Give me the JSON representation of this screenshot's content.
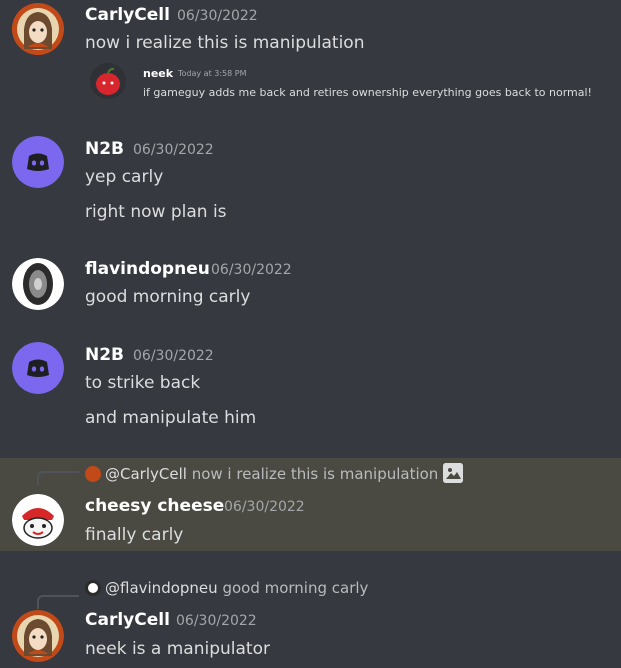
{
  "messages": [
    {
      "username": "CarlyCell",
      "timestamp": "06/30/2022",
      "lines": [
        "now i realize this is manipulation"
      ],
      "embed": {
        "username": "neek",
        "timestamp": "Today at 3:58 PM",
        "text": "if gameguy adds me back and retires ownership everything goes back to normal!"
      }
    },
    {
      "username": "N2B",
      "timestamp": "06/30/2022",
      "lines": [
        "yep carly",
        "right now plan is"
      ]
    },
    {
      "username": "flavindopneu",
      "timestamp": "06/30/2022",
      "lines": [
        "good morning carly"
      ]
    },
    {
      "username": "N2B",
      "timestamp": "06/30/2022",
      "lines": [
        "to strike back",
        "and manipulate him"
      ]
    },
    {
      "reply": {
        "mention": "@CarlyCell",
        "text": "now i realize this is manipulation",
        "has_image": true
      },
      "username": "cheesy cheese",
      "timestamp": "06/30/2022",
      "lines": [
        "finally carly"
      ]
    },
    {
      "reply": {
        "mention": "@flavindopneu",
        "text": "good morning carly"
      },
      "username": "CarlyCell",
      "timestamp": "06/30/2022",
      "lines": [
        "neek is a manipulator"
      ]
    }
  ],
  "colors": {
    "background": "#36393f",
    "highlight": "#4b4a42",
    "username": "#ffffff",
    "timestamp": "#a3a6aa",
    "text": "#dcddde",
    "discord_blurple": "#7b68ee"
  },
  "icons": {
    "carlycell_avatar": "anime-avatar",
    "n2b_avatar": "discord-default-avatar",
    "flavindopneu_avatar": "tire-avatar",
    "cheesy_avatar": "mascot-avatar",
    "neek_avatar": "apple-avatar",
    "image_attachment": "image-icon"
  }
}
